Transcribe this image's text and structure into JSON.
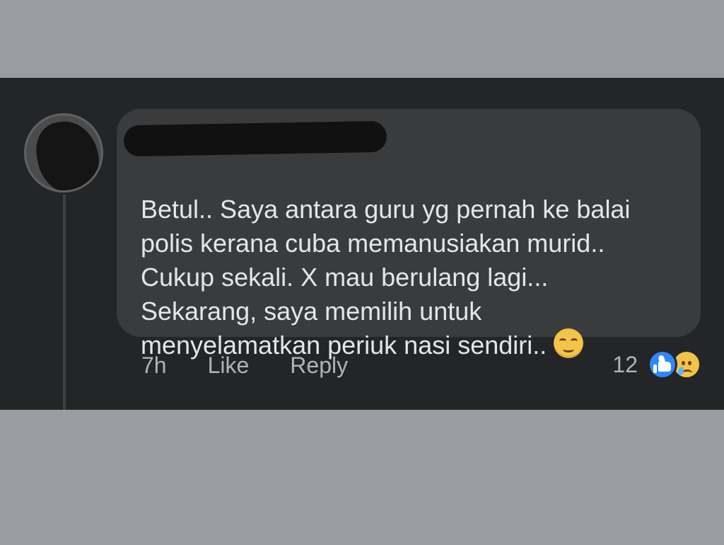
{
  "comment": {
    "author_name": "",
    "body": "Betul.. Saya antara guru yg pernah ke balai\npolis kerana cuba memanusiakan murid..\nCukup sekali. X mau berulang lagi...\nSekarang, saya memilih untuk\nmenyelamatkan periuk nasi sendiri..",
    "inline_emoji": "relieved-face-icon"
  },
  "actions": {
    "timestamp": "7h",
    "like_label": "Like",
    "reply_label": "Reply"
  },
  "reactions": {
    "count": "12",
    "icons": [
      "like-reaction-icon",
      "sad-reaction-icon"
    ]
  },
  "colors": {
    "page_background": "#9a9ba3",
    "panel_background": "#242527",
    "bubble_background": "#3a3b3c",
    "primary_text": "#e4e6eb",
    "secondary_text": "#b0b3b8",
    "like_blue": "#2d88ff",
    "emoji_yellow": "#f3c44a"
  }
}
